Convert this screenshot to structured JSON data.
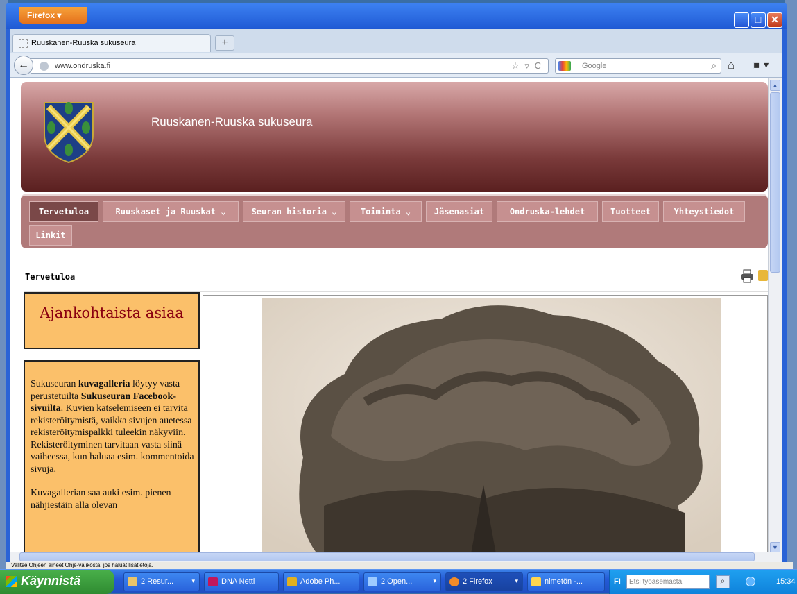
{
  "browser": {
    "menu_button": "Firefox",
    "tab_title": "Ruuskanen-Ruuska sukuseura",
    "new_tab": "+",
    "url": "www.ondruska.fi",
    "search_placeholder": "Google",
    "status_text": "Valitse Ohjeen aiheet Ohje-valikosta, jos haluat lisätietoja."
  },
  "site": {
    "title": "Ruuskanen-Ruuska sukuseura",
    "menu": [
      {
        "label": "Tervetuloa"
      },
      {
        "label": "Ruuskaset ja Ruuskat ⌄"
      },
      {
        "label": "Seuran historia ⌄"
      },
      {
        "label": "Toiminta ⌄"
      },
      {
        "label": "Jäsenasiat"
      },
      {
        "label": "Ondruska-lehdet"
      },
      {
        "label": "Tuotteet"
      },
      {
        "label": "Yhteystiedot"
      },
      {
        "label": "Linkit"
      }
    ],
    "breadcrumb": "Tervetuloa",
    "news_heading": "Ajankohtaista asiaa",
    "para1": {
      "t1": "Sukuseuran ",
      "b1": "kuvagalleria",
      "t2": " löytyy vasta perustetuilta ",
      "b2": "Sukuseuran Facebook-sivuilta",
      "t3": ". Kuvien katselemiseen ei tarvita rekisteröitymistä, vaikka sivujen auetessa rekisteröitymispalkki tuleekin näkyviin. Rekisteröityminen tarvitaan vasta siinä vaiheessa, kun haluaa esim. kommentoida sivuja."
    },
    "para2": "Kuvagallerian saa auki esim. pienen nähjiestäin alla olevan"
  },
  "taskbar": {
    "start": "Käynnistä",
    "buttons": [
      {
        "label": "2 Resur...",
        "color": "#e9c46a"
      },
      {
        "label": "DNA Netti",
        "color": "#c2185b"
      },
      {
        "label": "Adobe Ph...",
        "color": "#e0b020"
      },
      {
        "label": "2 Open...",
        "color": "#9ecbff"
      },
      {
        "label": "2 Firefox",
        "color": "#f28c28"
      },
      {
        "label": "nimetön -...",
        "color": "#ffd54f"
      }
    ],
    "lang": "FI",
    "search_placeholder": "Etsi työasemasta",
    "clock": "15:34"
  }
}
